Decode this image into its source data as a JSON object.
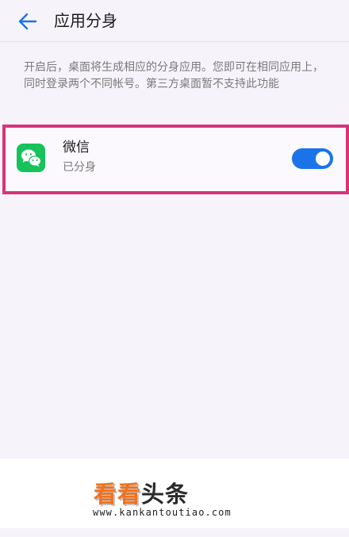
{
  "header": {
    "title": "应用分身",
    "back_icon": "arrow-left-icon"
  },
  "description": "开启后，桌面将生成相应的分身应用。您即可在相同应用上，同时登录两个不同帐号。第三方桌面暂不支持此功能",
  "apps": [
    {
      "name": "微信",
      "status": "已分身",
      "icon": "wechat-icon",
      "enabled": true
    }
  ],
  "colors": {
    "accent": "#1a73e8",
    "highlight_border": "#d8347a",
    "wechat_green": "#16c25a"
  },
  "watermark": {
    "brand_a": "看看",
    "brand_b": "头条",
    "url": "www.kankantoutiao.com"
  }
}
